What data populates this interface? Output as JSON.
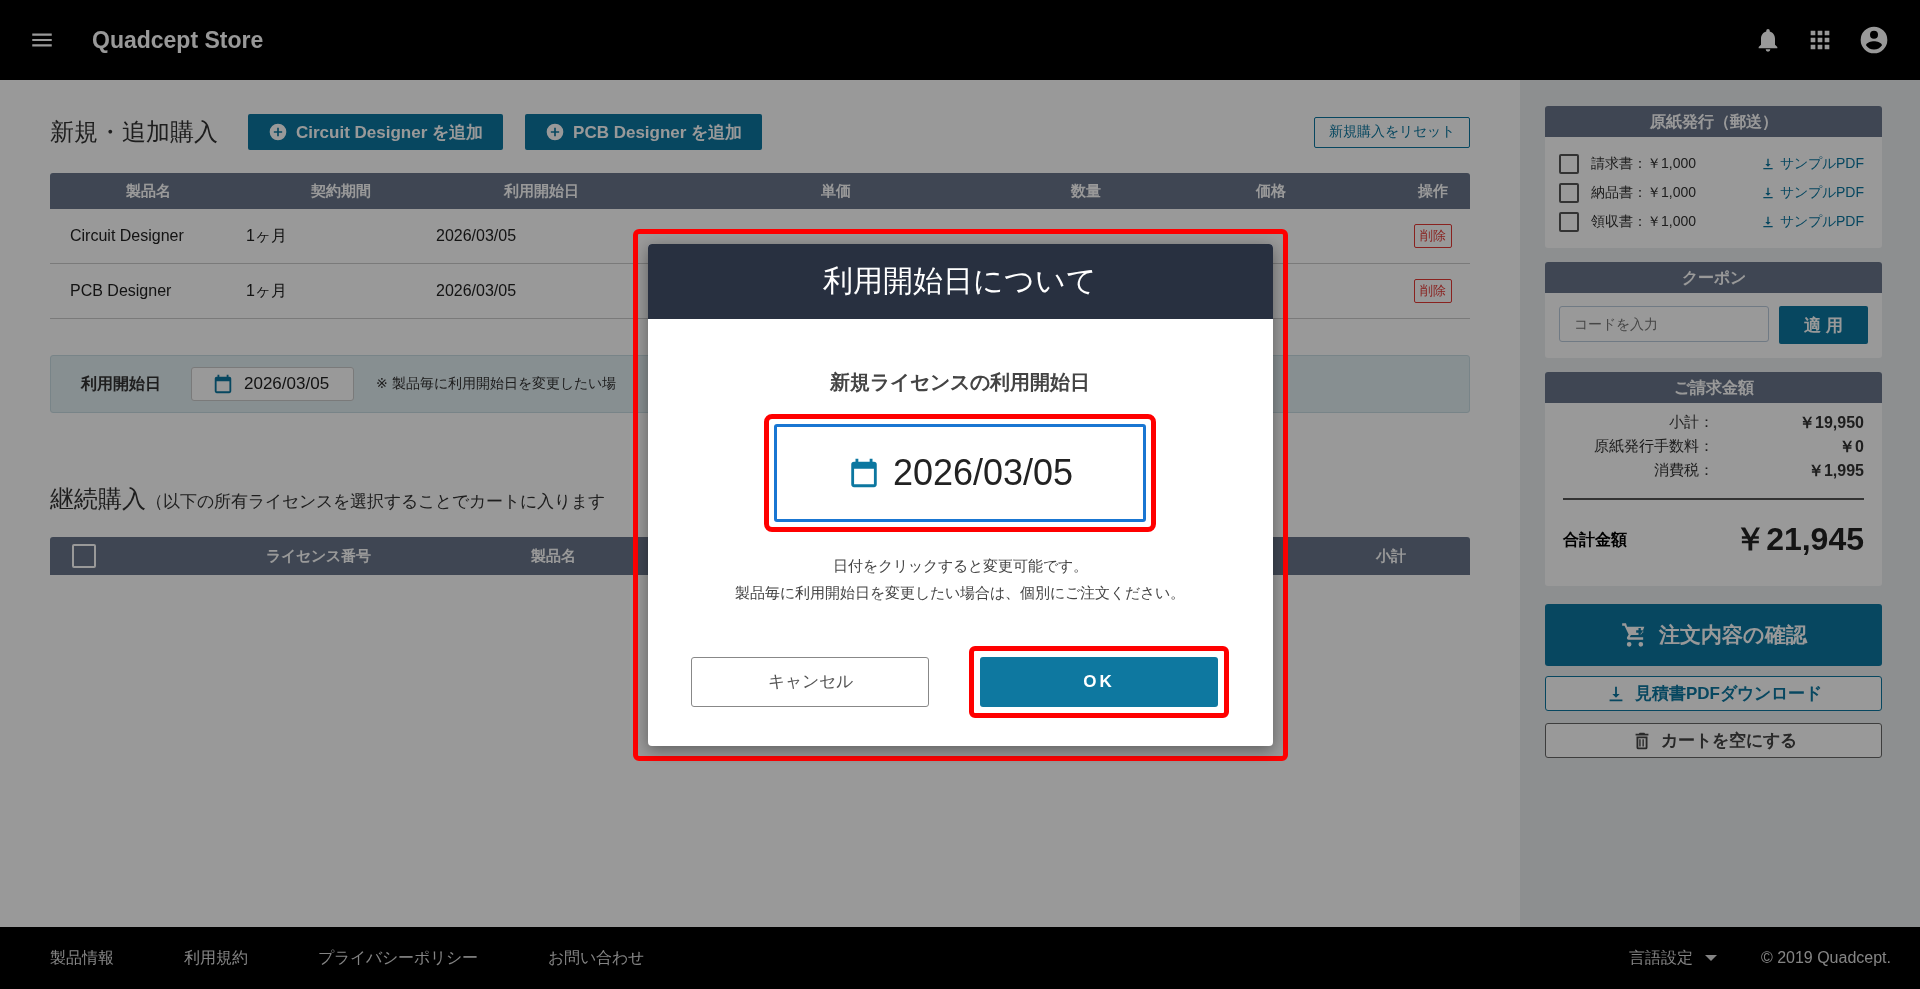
{
  "app_bar": {
    "title": "Quadcept Store"
  },
  "new_purchase": {
    "title": "新規・追加購入",
    "add_buttons": [
      "Circuit Designer を追加",
      "PCB Designer を追加"
    ],
    "reset_button": "新規購入をリセット",
    "table": {
      "columns": [
        "製品名",
        "契約期間",
        "利用開始日",
        "単価",
        "数量",
        "価格",
        "操作"
      ],
      "rows": [
        {
          "product": "Circuit Designer",
          "term": "1ヶ月",
          "start_date": "2026/03/05",
          "action": "削除"
        },
        {
          "product": "PCB Designer",
          "term": "1ヶ月",
          "start_date": "2026/03/05",
          "action": "削除"
        }
      ]
    },
    "start_date_bar": {
      "label": "利用開始日",
      "date": "2026/03/05",
      "note": "※ 製品毎に利用開始日を変更したい場"
    }
  },
  "renewal": {
    "title": "継続購入",
    "note": "（以下の所有ライセンスを選択することでカートに入ります",
    "table": {
      "select_all_checked": false,
      "columns": [
        "ライセンス番号",
        "製品名",
        "小計"
      ]
    }
  },
  "sidebar": {
    "paper_issue": {
      "title": "原紙発行（郵送）",
      "items": [
        {
          "label": "請求書：￥1,000",
          "checked": false,
          "link": "サンプルPDF"
        },
        {
          "label": "納品書：￥1,000",
          "checked": false,
          "link": "サンプルPDF"
        },
        {
          "label": "領収書：￥1,000",
          "checked": false,
          "link": "サンプルPDF"
        }
      ]
    },
    "coupon": {
      "title": "クーポン",
      "placeholder": "コードを入力",
      "button": "適 用"
    },
    "billing": {
      "title": "ご請求金額",
      "lines": [
        {
          "label": "小計：",
          "value": "￥19,950"
        },
        {
          "label": "原紙発行手数料：",
          "value": "￥0"
        },
        {
          "label": "消費税：",
          "value": "￥1,995"
        }
      ],
      "total_label": "合計金額",
      "total": "￥21,945"
    },
    "confirm_button": "注文内容の確認",
    "estimate_button": "見積書PDFダウンロード",
    "empty_cart_button": "カートを空にする"
  },
  "modal": {
    "title": "利用開始日について",
    "highlighted": true,
    "subtitle": "新規ライセンスの利用開始日",
    "date": "2026/03/05",
    "date_highlighted": true,
    "help": [
      "日付をクリックすると変更可能です。",
      "製品毎に利用開始日を変更したい場合は、個別にご注文ください。"
    ],
    "cancel_button": "キャンセル",
    "ok_button": "OK",
    "ok_highlighted": true
  },
  "footer": {
    "links": [
      "製品情報",
      "利用規約",
      "プライバシーポリシー",
      "お問い合わせ"
    ],
    "language": "言語設定",
    "copyright": "© 2019 Quadcept."
  }
}
